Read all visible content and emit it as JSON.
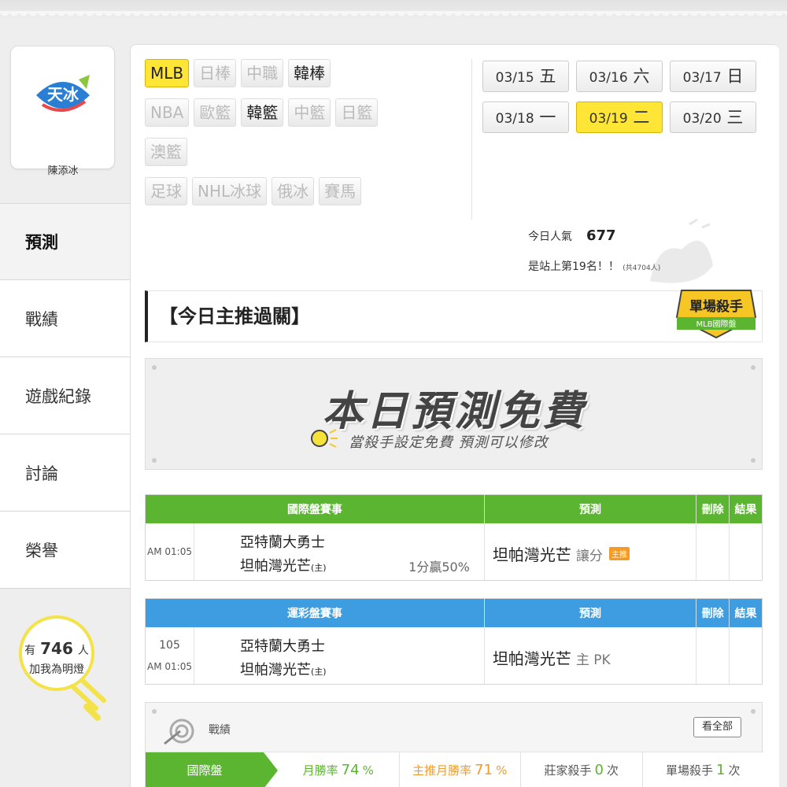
{
  "user": {
    "name": "陳添冰",
    "logo_text": "天冰"
  },
  "nav": [
    "預測",
    "戰績",
    "遊戲紀錄",
    "討論",
    "榮譽"
  ],
  "lamp": {
    "prefix": "有",
    "count": "746",
    "suffix": "人",
    "line2": "加我為明燈"
  },
  "leagues": [
    [
      {
        "label": "MLB",
        "state": "active"
      },
      {
        "label": "日棒",
        "state": "disabled"
      },
      {
        "label": "中職",
        "state": "disabled"
      },
      {
        "label": "韓棒",
        "state": "normal"
      }
    ],
    [
      {
        "label": "NBA",
        "state": "disabled"
      },
      {
        "label": "歐籃",
        "state": "disabled"
      },
      {
        "label": "韓籃",
        "state": "normal"
      },
      {
        "label": "中籃",
        "state": "disabled"
      },
      {
        "label": "日籃",
        "state": "disabled"
      }
    ],
    [
      {
        "label": "澳籃",
        "state": "disabled"
      }
    ],
    [
      {
        "label": "足球",
        "state": "disabled"
      },
      {
        "label": "NHL冰球",
        "state": "disabled"
      },
      {
        "label": "俄冰",
        "state": "disabled"
      },
      {
        "label": "賽馬",
        "state": "disabled"
      }
    ]
  ],
  "dates": [
    [
      {
        "md": "03/15",
        "dow": "五"
      },
      {
        "md": "03/16",
        "dow": "六"
      },
      {
        "md": "03/17",
        "dow": "日"
      }
    ],
    [
      {
        "md": "03/18",
        "dow": "一"
      },
      {
        "md": "03/19",
        "dow": "二",
        "active": true
      },
      {
        "md": "03/20",
        "dow": "三"
      }
    ]
  ],
  "popularity": {
    "label": "今日人氣",
    "value": "677",
    "rank_text": "是站上第19名！！",
    "total": "(共4704人)"
  },
  "section_title": "【今日主推過關】",
  "badge": {
    "line1": "單場殺手",
    "line2": "MLB國際盤"
  },
  "free_banner": {
    "title": "本日預測免費",
    "sub": "當殺手設定免費  預測可以修改"
  },
  "intl_table": {
    "headers": [
      "國際盤賽事",
      "預測",
      "刪除",
      "結果"
    ],
    "time": "AM 01:05",
    "team_a": "亞特蘭大勇士",
    "team_b": "坦帕灣光芒",
    "team_b_tag": "(主)",
    "handicap": "1分贏50%",
    "pick": "坦帕灣光芒",
    "pick_sub": "讓分",
    "pick_tag": "主推"
  },
  "lottery_table": {
    "headers": [
      "運彩盤賽事",
      "預測",
      "刪除",
      "結果"
    ],
    "game_no": "105",
    "time": "AM 01:05",
    "team_a": "亞特蘭大勇士",
    "team_b": "坦帕灣光芒",
    "team_b_tag": "(主)",
    "pick": "坦帕灣光芒",
    "pick_sub": "主 PK"
  },
  "record": {
    "label": "戰績",
    "view_all": "看全部",
    "tab": "國際盤",
    "month_rate_label": "月勝率",
    "month_rate": "74",
    "month_rate_unit": "%",
    "main_rate_label": "主推月勝率",
    "main_rate": "71",
    "main_rate_unit": "%",
    "banker_label": "莊家殺手",
    "banker": "0",
    "banker_unit": "次",
    "single_label": "單場殺手",
    "single": "1",
    "single_unit": "次"
  },
  "colors": {
    "green": "#5cb531",
    "blue": "#3d9de0",
    "yellow": "#ffe535",
    "orange": "#f39b26"
  }
}
